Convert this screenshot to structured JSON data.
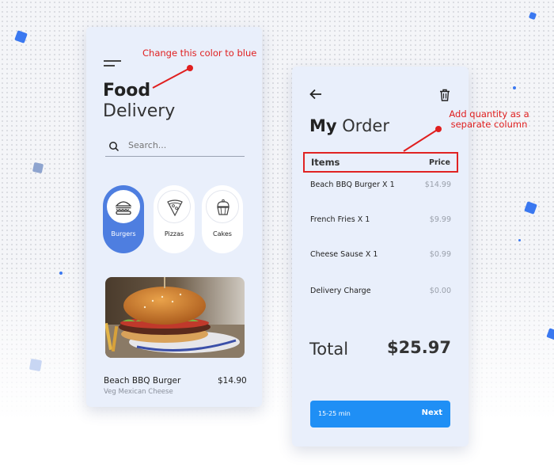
{
  "colors": {
    "card_bg": "#e9effb",
    "accent_blue": "#4e7ee0",
    "button_blue": "#1f8ff5",
    "annotation_red": "#e01f1f",
    "deco_blue": "#3a78f0"
  },
  "left_card": {
    "menu_icon": "hamburger-icon",
    "title_bold": "Food",
    "title_regular": "Delivery",
    "search": {
      "placeholder": "Search...",
      "icon": "search-icon"
    },
    "categories": [
      {
        "label": "Burgers",
        "icon": "burger-icon",
        "active": true
      },
      {
        "label": "Pizzas",
        "icon": "pizza-icon",
        "active": false
      },
      {
        "label": "Cakes",
        "icon": "cupcake-icon",
        "active": false
      }
    ],
    "featured": {
      "name": "Beach BBQ Burger",
      "subtitle": "Veg Mexican Cheese",
      "price": "$14.90"
    }
  },
  "right_card": {
    "back_icon": "arrow-left-icon",
    "trash_icon": "trash-icon",
    "title_bold": "My",
    "title_regular": "Order",
    "columns": {
      "items": "Items",
      "price": "Price"
    },
    "rows": [
      {
        "name": "Beach  BBQ Burger X 1",
        "price": "$14.99"
      },
      {
        "name": "French Fries X 1",
        "price": "$9.99"
      },
      {
        "name": "Cheese Sause X 1",
        "price": "$0.99"
      },
      {
        "name": "Delivery Charge",
        "price": "$0.00"
      }
    ],
    "total_label": "Total",
    "total_value": "$25.97",
    "eta": "15-25 min",
    "next_label": "Next"
  },
  "annotations": {
    "note1": "Change this color to blue",
    "note2_line1": "Add quantity as a",
    "note2_line2": "separate column"
  }
}
